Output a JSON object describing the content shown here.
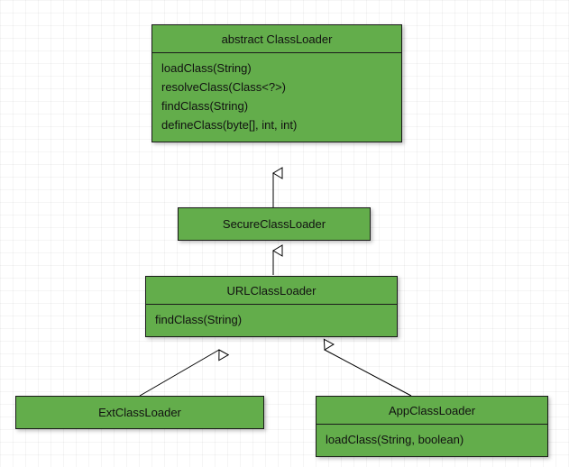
{
  "diagram": {
    "type": "uml-class-hierarchy",
    "classes": {
      "cl": {
        "title": "abstract ClassLoader",
        "ops": [
          "loadClass(String)",
          "resolveClass(Class<?>)",
          "findClass(String)",
          "defineClass(byte[], int, int)"
        ]
      },
      "scl": {
        "title": "SecureClassLoader",
        "ops": []
      },
      "ucl": {
        "title": "URLClassLoader",
        "ops": [
          "findClass(String)"
        ]
      },
      "ext": {
        "title": "ExtClassLoader",
        "ops": []
      },
      "app": {
        "title": "AppClassLoader",
        "ops": [
          "loadClass(String, boolean)"
        ]
      }
    },
    "inheritance": [
      {
        "child": "scl",
        "parent": "cl"
      },
      {
        "child": "ucl",
        "parent": "scl"
      },
      {
        "child": "ext",
        "parent": "ucl"
      },
      {
        "child": "app",
        "parent": "ucl"
      }
    ]
  }
}
